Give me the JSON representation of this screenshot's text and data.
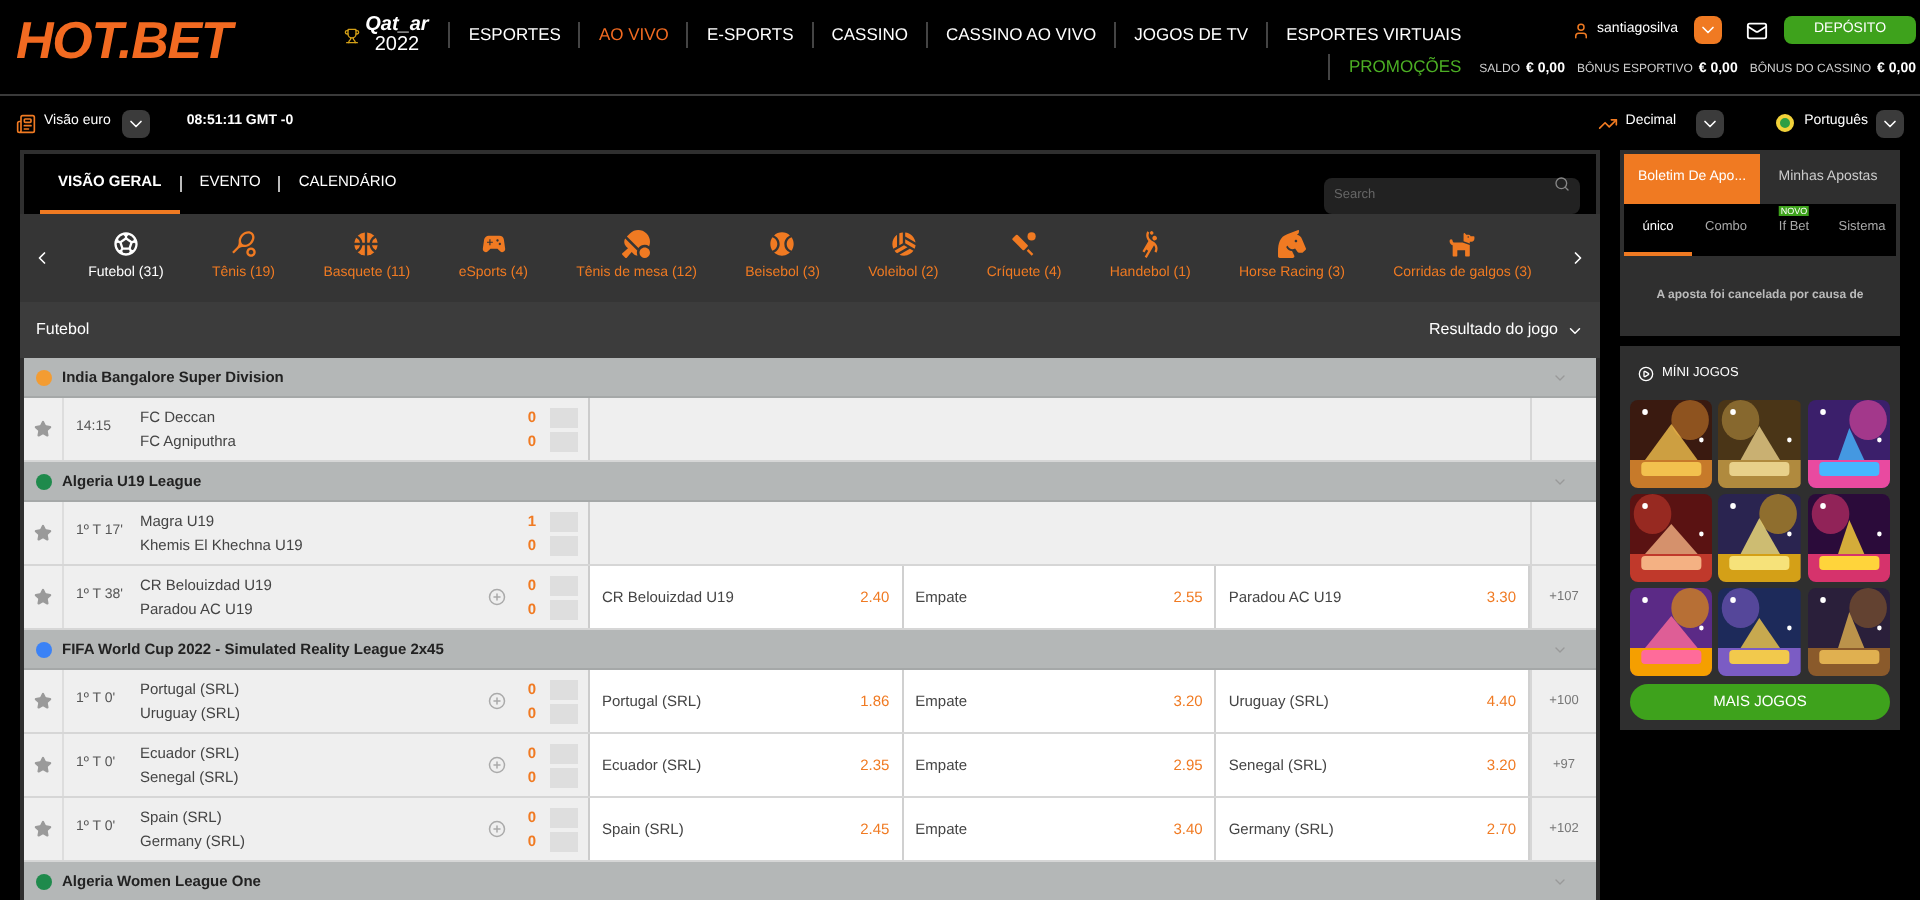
{
  "header": {
    "logo": "HOT.BET",
    "event_logo": {
      "line1": "Qat_ar",
      "line2": "2022"
    },
    "nav": [
      {
        "label": "ESPORTES",
        "selected": false
      },
      {
        "label": "AO VIVO",
        "selected": true
      },
      {
        "label": "E-SPORTS",
        "selected": false
      },
      {
        "label": "CASSINO",
        "selected": false
      },
      {
        "label": "CASSINO AO VIVO",
        "selected": false
      },
      {
        "label": "JOGOS DE TV",
        "selected": false
      },
      {
        "label": "ESPORTES VIRTUAIS",
        "selected": false
      }
    ],
    "promo_link": "PROMOÇÕES",
    "username": "santiagosilva",
    "deposit_button": "DEPÓSITO",
    "balances": [
      {
        "label": "SALDO",
        "value": "€ 0,00"
      },
      {
        "label": "BÔNUS ESPORTIVO",
        "value": "€ 0,00"
      },
      {
        "label": "BÔNUS DO CASSINO",
        "value": "€ 0,00"
      }
    ]
  },
  "toolbar": {
    "view": "Visão euro",
    "clock": "08:51:11 GMT -0",
    "odds_format": "Decimal",
    "language": "Português"
  },
  "main_tabs": [
    {
      "label": "VISÃO GERAL",
      "selected": true
    },
    {
      "label": "EVENTO",
      "selected": false
    },
    {
      "label": "CALENDÁRIO",
      "selected": false
    }
  ],
  "search": {
    "placeholder": "Search"
  },
  "sports": [
    {
      "kind": "soccer",
      "label": "Futebol (31)",
      "selected": true
    },
    {
      "kind": "tennis",
      "label": "Tênis (19)",
      "selected": false
    },
    {
      "kind": "basketball",
      "label": "Basquete (11)",
      "selected": false
    },
    {
      "kind": "esports",
      "label": "eSports (4)",
      "selected": false
    },
    {
      "kind": "table-tennis",
      "label": "Tênis de mesa (12)",
      "selected": false
    },
    {
      "kind": "baseball",
      "label": "Beisebol (3)",
      "selected": false
    },
    {
      "kind": "volleyball",
      "label": "Voleibol (2)",
      "selected": false
    },
    {
      "kind": "cricket",
      "label": "Críquete (4)",
      "selected": false
    },
    {
      "kind": "handball",
      "label": "Handebol (1)",
      "selected": false
    },
    {
      "kind": "horse",
      "label": "Horse Racing (3)",
      "selected": false
    },
    {
      "kind": "dog",
      "label": "Corridas de galgos (3)",
      "selected": false
    }
  ],
  "section": {
    "title": "Futebol",
    "market": "Resultado do jogo"
  },
  "leagues": [
    {
      "name": "India Bangalore Super Division",
      "color": "#f39c32",
      "matches": [
        {
          "time": "14:15",
          "teams": [
            {
              "name": "FC Deccan",
              "score": "0"
            },
            {
              "name": "FC Agniputhra",
              "score": "0"
            }
          ]
        }
      ]
    },
    {
      "name": "Algeria U19 League",
      "color": "#1f8a4c",
      "matches": [
        {
          "time": "1º T 17'",
          "teams": [
            {
              "name": "Magra U19",
              "score": "1"
            },
            {
              "name": "Khemis El Khechna U19",
              "score": "0"
            }
          ]
        },
        {
          "time": "1º T 38'",
          "teams": [
            {
              "name": "CR Belouizdad U19",
              "score": "0"
            },
            {
              "name": "Paradou AC U19",
              "score": "0"
            }
          ],
          "odds": [
            {
              "label": "CR Belouizdad U19",
              "price": "2.40"
            },
            {
              "label": "Empate",
              "price": "2.55"
            },
            {
              "label": "Paradou AC U19",
              "price": "3.30"
            }
          ],
          "more": "+107"
        }
      ]
    },
    {
      "name": "FIFA World Cup 2022 - Simulated Reality League 2x45",
      "color": "#3b82f6",
      "matches": [
        {
          "time": "1º T 0'",
          "teams": [
            {
              "name": "Portugal (SRL)",
              "score": "0"
            },
            {
              "name": "Uruguay (SRL)",
              "score": "0"
            }
          ],
          "odds": [
            {
              "label": "Portugal (SRL)",
              "price": "1.86"
            },
            {
              "label": "Empate",
              "price": "3.20"
            },
            {
              "label": "Uruguay (SRL)",
              "price": "4.40"
            }
          ],
          "more": "+100"
        },
        {
          "time": "1º T 0'",
          "teams": [
            {
              "name": "Ecuador (SRL)",
              "score": "0"
            },
            {
              "name": "Senegal (SRL)",
              "score": "0"
            }
          ],
          "odds": [
            {
              "label": "Ecuador (SRL)",
              "price": "2.35"
            },
            {
              "label": "Empate",
              "price": "2.95"
            },
            {
              "label": "Senegal (SRL)",
              "price": "3.20"
            }
          ],
          "more": "+97"
        },
        {
          "time": "1º T 0'",
          "teams": [
            {
              "name": "Spain (SRL)",
              "score": "0"
            },
            {
              "name": "Germany (SRL)",
              "score": "0"
            }
          ],
          "odds": [
            {
              "label": "Spain (SRL)",
              "price": "2.45"
            },
            {
              "label": "Empate",
              "price": "3.40"
            },
            {
              "label": "Germany (SRL)",
              "price": "2.70"
            }
          ],
          "more": "+102"
        }
      ]
    },
    {
      "name": "Algeria Women League One",
      "color": "#1f8a4c"
    }
  ],
  "betslip": {
    "tabs": [
      {
        "label": "Boletim De Apo...",
        "selected": true
      },
      {
        "label": "Minhas Apostas",
        "selected": false
      }
    ],
    "bet_types": [
      {
        "label": "único",
        "selected": true
      },
      {
        "label": "Combo",
        "selected": false
      },
      {
        "label": "If Bet",
        "selected": false,
        "badge": "NOVO"
      },
      {
        "label": "Sistema",
        "selected": false
      }
    ],
    "message": "A aposta foi cancelada por causa de"
  },
  "mini_games": {
    "title": "MÍNI JOGOS",
    "button": "MAIS JOGOS"
  }
}
